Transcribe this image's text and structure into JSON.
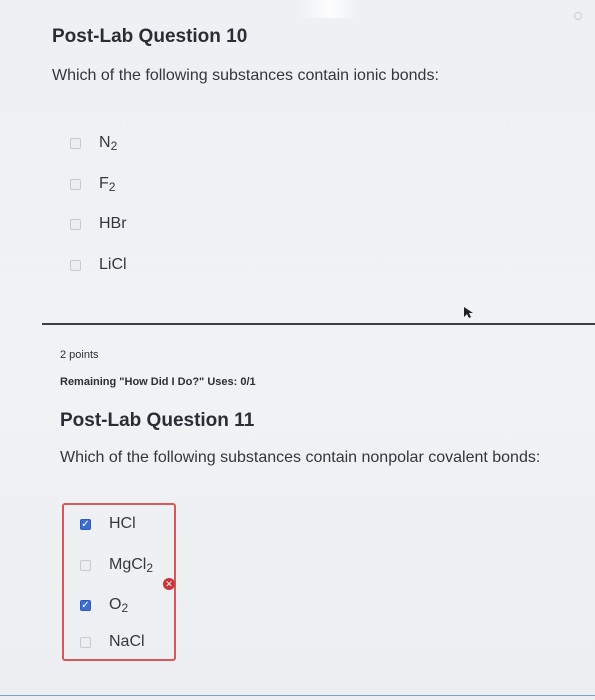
{
  "q10": {
    "title": "Post-Lab Question 10",
    "question": "Which of the following substances contain ionic bonds:",
    "options": [
      {
        "base": "N",
        "sub": "2",
        "checked": false
      },
      {
        "base": "F",
        "sub": "2",
        "checked": false
      },
      {
        "base": "HBr",
        "sub": "",
        "checked": false
      },
      {
        "base": "LiCl",
        "sub": "",
        "checked": false
      }
    ]
  },
  "meta": {
    "points": "2 points",
    "remaining": "Remaining \"How Did I Do?\" Uses: 0/1"
  },
  "q11": {
    "title": "Post-Lab Question 11",
    "question": "Which of the following substances contain nonpolar covalent bonds:",
    "options": [
      {
        "base": "HCl",
        "sub": "",
        "checked": true
      },
      {
        "base": "MgCl",
        "sub": "2",
        "checked": false
      },
      {
        "base": "O",
        "sub": "2",
        "checked": true
      },
      {
        "base": "NaCl",
        "sub": "",
        "checked": false
      }
    ],
    "result": "incorrect"
  },
  "colors": {
    "checkbox_checked": "#3d6fd1",
    "incorrect_border": "#d45a5a",
    "incorrect_icon": "#c8343b",
    "divider": "#3b4048"
  },
  "icons": {
    "incorrect": "x-circle-icon",
    "cursor": "mouse-pointer-icon"
  }
}
